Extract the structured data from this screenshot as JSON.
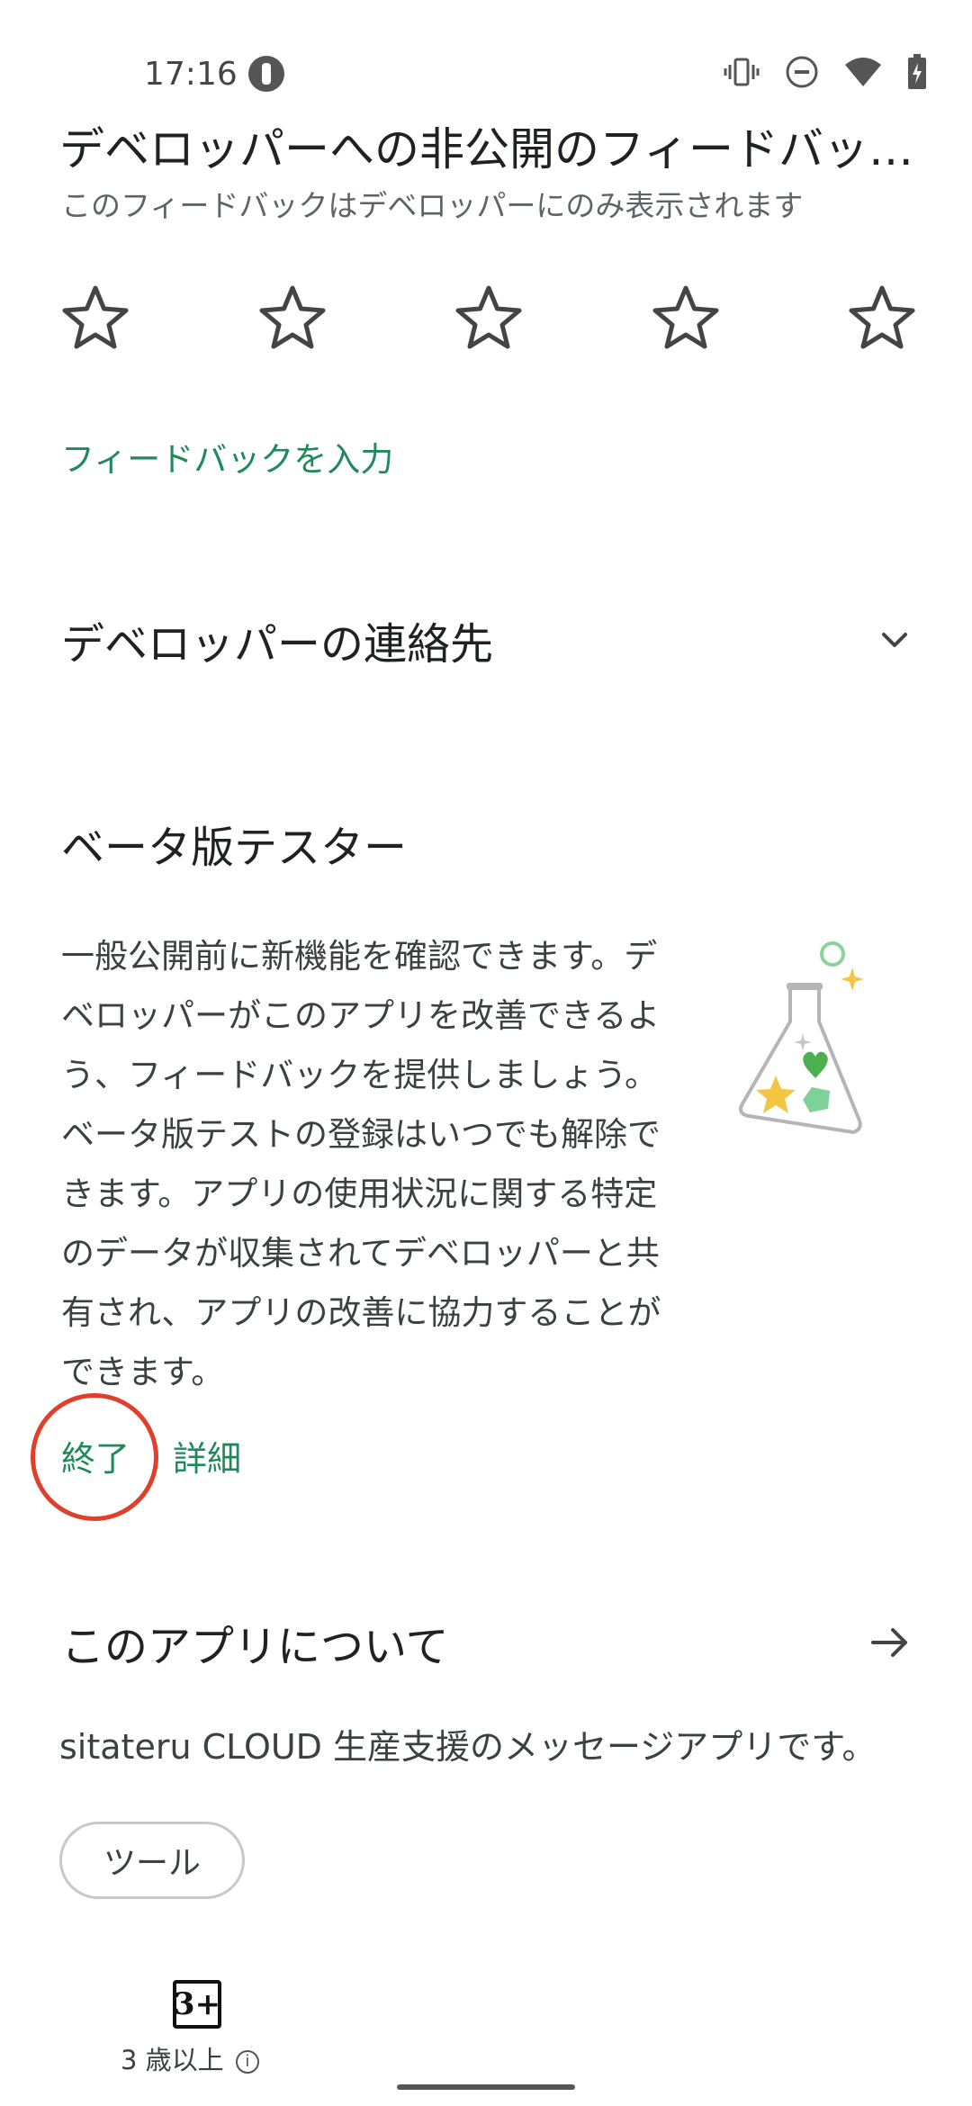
{
  "status_bar": {
    "time": "17:16",
    "icons": [
      "app-notification-icon",
      "vibrate-icon",
      "do-not-disturb-icon",
      "wifi-icon",
      "battery-charging-icon"
    ]
  },
  "feedback_section": {
    "title": "デベロッパーへの非公開のフィードバッ…",
    "subtitle": "このフィードバックはデベロッパーにのみ表示されます",
    "star_count": 5,
    "rating": 0,
    "input_link": "フィードバックを入力"
  },
  "contact_section": {
    "title": "デベロッパーの連絡先",
    "icon": "chevron-down-icon"
  },
  "beta_section": {
    "title": "ベータ版テスター",
    "description": "一般公開前に新機能を確認できます。デベロッパーがこのアプリを改善できるよう、フィードバックを提供しましょう。ベータ版テストの登録はいつでも解除できます。アプリの使用状況に関する特定のデータが収集されてデベロッパーと共有され、アプリの改善に協力することができます。",
    "leave_label": "終了",
    "details_label": "詳細",
    "illustration": "flask-icon"
  },
  "about_section": {
    "title": "このアプリについて",
    "icon": "arrow-right-icon",
    "description": "sitateru CLOUD 生産支援のメッセージアプリです。",
    "category_chip": "ツール"
  },
  "content_rating": {
    "badge": "3+",
    "label": "3 歳以上"
  },
  "colors": {
    "accent_green": "#1e8a5a",
    "highlight_red": "#e0402b",
    "text_primary": "#202124",
    "text_secondary": "#5f6368"
  }
}
